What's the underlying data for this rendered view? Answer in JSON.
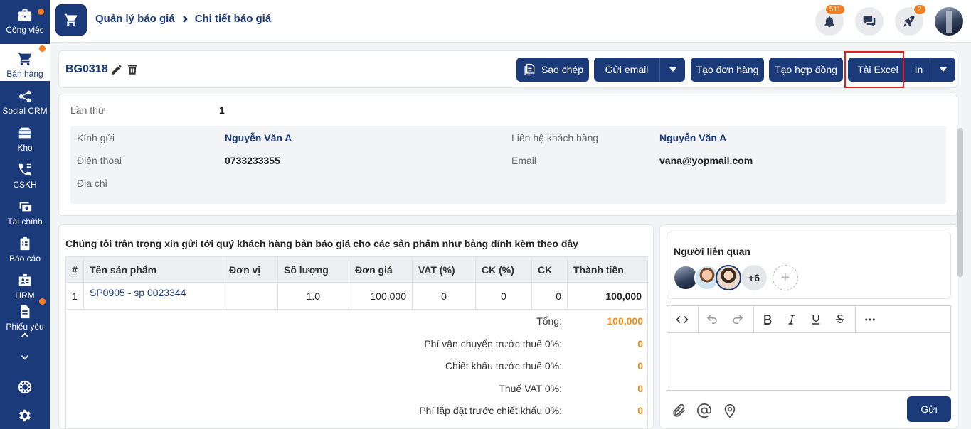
{
  "sidebar": {
    "items": [
      {
        "label": "Công việc",
        "dot": true
      },
      {
        "label": "Bán hàng",
        "dot": true,
        "active": true
      },
      {
        "label": "Social CRM"
      },
      {
        "label": "Kho"
      },
      {
        "label": "CSKH"
      },
      {
        "label": "Tài chính"
      },
      {
        "label": "Báo cáo"
      },
      {
        "label": "HRM"
      },
      {
        "label": "Phiếu yêu",
        "dot": true
      }
    ]
  },
  "header": {
    "breadcrumb_1": "Quản lý báo giá",
    "breadcrumb_2": "Chi tiết báo giá",
    "notifications_count": "511",
    "rocket_count": "2"
  },
  "title_bar": {
    "code": "BG0318",
    "buttons": {
      "copy": "Sao chép",
      "email": "Gửi email",
      "create_order": "Tạo đơn hàng",
      "create_contract": "Tạo hợp đồng",
      "download_excel": "Tải Excel",
      "print": "In"
    }
  },
  "info": {
    "attempt_label": "Lần thứ",
    "attempt_value": "1",
    "to_label": "Kính gửi",
    "to_value": "Nguyễn Văn A",
    "contact_label": "Liên hệ khách hàng",
    "contact_value": "Nguyễn Văn A",
    "phone_label": "Điện thoại",
    "phone_value": "0733233355",
    "email_label": "Email",
    "email_value": "vana@yopmail.com",
    "address_label": "Địa chỉ"
  },
  "products": {
    "intro": "Chúng tôi trân trọng xin gửi tới quý khách hàng bản báo giá cho các sản phẩm như bảng đính kèm theo đây",
    "columns": [
      "#",
      "Tên sản phẩm",
      "Đơn vị",
      "Số lượng",
      "Đơn giá",
      "VAT (%)",
      "CK (%)",
      "CK",
      "Thành tiền"
    ],
    "rows": [
      [
        "1",
        "SP0905 - sp 0023344",
        "",
        "1.0",
        "100,000",
        "0",
        "0",
        "0",
        "100,000"
      ]
    ],
    "summary": [
      {
        "label": "Tổng:",
        "value": "100,000"
      },
      {
        "label": "Phí vận chuyển trước thuế 0%:",
        "value": "0"
      },
      {
        "label": "Chiết khấu trước thuế 0%:",
        "value": "0"
      },
      {
        "label": "Thuế VAT 0%:",
        "value": "0"
      },
      {
        "label": "Phí lắp đặt trước chiết khấu 0%:",
        "value": "0"
      }
    ]
  },
  "related": {
    "title": "Người liên quan",
    "more": "+6",
    "add": "+"
  },
  "editor": {
    "send": "Gửi"
  },
  "colors": {
    "primary": "#1b3a7a",
    "accent": "#f08c1a",
    "highlight": "#e02020"
  }
}
